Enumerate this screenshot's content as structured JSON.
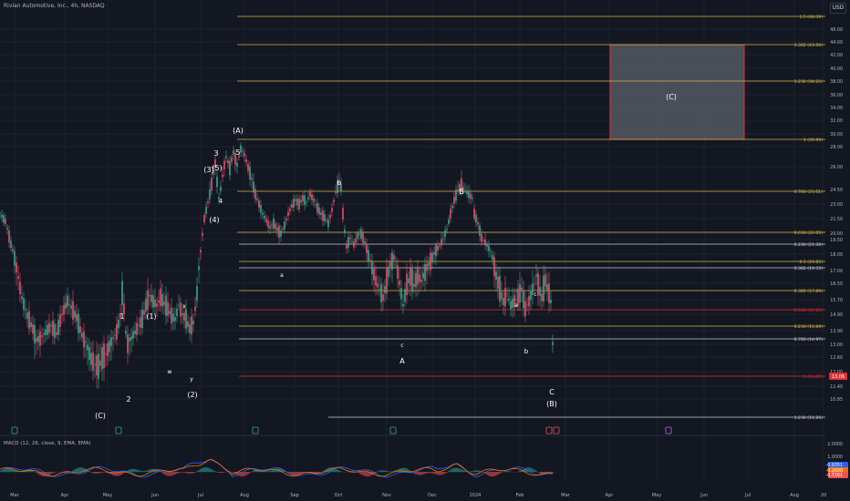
{
  "header": {
    "symbol_title": "Rivian Automotive, Inc., 4h, NASDAQ",
    "currency": "USD"
  },
  "macd": {
    "title": "MACD (12, 26, close, 9, EMA, EMA)",
    "labels": [
      "2.0000",
      "1.0000",
      "-0.9351",
      "-0.2698",
      "-0.7161"
    ]
  },
  "colors": {
    "background": "#131722",
    "fib_line": "#d4b742",
    "fib_white": "#c9cbd2",
    "fib_red": "#e03131",
    "zone_fill": "#787b86",
    "candle_up": "#3aa68e",
    "candle_down": "#e8506a",
    "macd_line": "#2962ff",
    "signal_line": "#ff6d00"
  },
  "price_axis": [
    "46.00",
    "44.00",
    "42.00",
    "40.00",
    "38.00",
    "36.00",
    "34.00",
    "32.00",
    "30.00",
    "28.00",
    "26.00",
    "24.50",
    "23.00",
    "21.50",
    "20.00",
    "19.50",
    "18.00",
    "17.00",
    "16.50",
    "15.70",
    "14.90",
    "13.90",
    "13.00",
    "12.60",
    "12.00",
    "11.40",
    "10.85"
  ],
  "time_axis": [
    "Mar",
    "Apr",
    "May",
    "Jun",
    "Jul",
    "Aug",
    "Sep",
    "Oct",
    "Nov",
    "Dec",
    "2024",
    "Feb",
    "Mar",
    "Apr",
    "May",
    "Jun",
    "Jul",
    "Aug",
    "20"
  ],
  "fib_levels": [
    {
      "label": "1.5 (48.39)",
      "color": "yellow"
    },
    {
      "label": "1.382 (43.56)",
      "color": "yellow"
    },
    {
      "label": "1.236 (38.25)",
      "color": "yellow"
    },
    {
      "label": "1 (30.99)",
      "color": "yellow"
    },
    {
      "label": "0.786 (25.61)",
      "color": "yellow"
    },
    {
      "label": "0.618 (22.05)",
      "color": "yellow"
    },
    {
      "label": "0.236 (21.30)",
      "color": "white"
    },
    {
      "label": "0.5 (19.85)",
      "color": "yellow"
    },
    {
      "label": "0.382 (19.33)",
      "color": "white"
    },
    {
      "label": "0.382 (17.89)",
      "color": "yellow"
    },
    {
      "label": "0.618 (16.65)",
      "color": "red"
    },
    {
      "label": "0.236 (15.69)",
      "color": "yellow"
    },
    {
      "label": "0.786 (14.97)",
      "color": "white"
    },
    {
      "label": "1 (13.07)",
      "color": "red"
    },
    {
      "label": "1.236 (11.26)",
      "color": "white"
    }
  ],
  "price_badge": "13.06",
  "zone_label": "(C)",
  "wave_labels": [
    "(A)",
    "5",
    "3",
    "(3)",
    "(5)",
    "(4)",
    "4",
    "1",
    "(1)",
    "x",
    "w",
    "y",
    "2",
    "(2)",
    "(C)",
    "b",
    "a",
    "c",
    "A",
    "B",
    "a",
    "b",
    "c",
    "C",
    "(B)"
  ],
  "price_series": [
    [
      0,
      22.0
    ],
    [
      6,
      21.2
    ],
    [
      12,
      19.0
    ],
    [
      18,
      17.2
    ],
    [
      24,
      15.8
    ],
    [
      30,
      14.8
    ],
    [
      36,
      14.0
    ],
    [
      40,
      13.3
    ],
    [
      44,
      13.4
    ],
    [
      50,
      13.8
    ],
    [
      56,
      14.2
    ],
    [
      62,
      13.7
    ],
    [
      68,
      14.9
    ],
    [
      74,
      15.6
    ],
    [
      78,
      15.3
    ],
    [
      84,
      14.7
    ],
    [
      90,
      13.6
    ],
    [
      96,
      12.9
    ],
    [
      100,
      12.5
    ],
    [
      104,
      12.3
    ],
    [
      108,
      12.2
    ],
    [
      112,
      12.5
    ],
    [
      116,
      12.7
    ],
    [
      120,
      13.0
    ],
    [
      124,
      13.4
    ],
    [
      128,
      13.8
    ],
    [
      132,
      14.8
    ],
    [
      134,
      16.0
    ],
    [
      136,
      15.2
    ],
    [
      138,
      13.8
    ],
    [
      140,
      13.2
    ],
    [
      144,
      13.4
    ],
    [
      148,
      13.8
    ],
    [
      152,
      14.2
    ],
    [
      156,
      14.6
    ],
    [
      160,
      15.4
    ],
    [
      164,
      15.9
    ],
    [
      168,
      15.6
    ],
    [
      172,
      15.4
    ],
    [
      176,
      15.8
    ],
    [
      180,
      15.5
    ],
    [
      184,
      15.2
    ],
    [
      188,
      14.8
    ],
    [
      192,
      14.6
    ],
    [
      196,
      15.4
    ],
    [
      200,
      14.9
    ],
    [
      204,
      14.6
    ],
    [
      208,
      14.0
    ],
    [
      212,
      14.4
    ],
    [
      216,
      16.0
    ],
    [
      220,
      18.3
    ],
    [
      224,
      21.5
    ],
    [
      228,
      23.2
    ],
    [
      232,
      24.8
    ],
    [
      236,
      26.3
    ],
    [
      238,
      25.0
    ],
    [
      240,
      23.6
    ],
    [
      244,
      25.4
    ],
    [
      248,
      27.0
    ],
    [
      252,
      26.0
    ],
    [
      256,
      27.4
    ],
    [
      260,
      26.2
    ],
    [
      264,
      27.8
    ],
    [
      268,
      27.2
    ],
    [
      272,
      26.0
    ],
    [
      276,
      25.2
    ],
    [
      280,
      24.0
    ],
    [
      284,
      23.0
    ],
    [
      288,
      22.0
    ],
    [
      292,
      21.3
    ],
    [
      296,
      20.6
    ],
    [
      300,
      21.0
    ],
    [
      304,
      20.4
    ],
    [
      308,
      20.0
    ],
    [
      312,
      20.8
    ],
    [
      316,
      22.0
    ],
    [
      320,
      22.8
    ],
    [
      324,
      23.4
    ],
    [
      328,
      23.0
    ],
    [
      332,
      23.6
    ],
    [
      336,
      23.2
    ],
    [
      340,
      24.0
    ],
    [
      344,
      23.4
    ],
    [
      348,
      22.6
    ],
    [
      352,
      22.0
    ],
    [
      356,
      21.6
    ],
    [
      360,
      21.0
    ],
    [
      364,
      22.4
    ],
    [
      368,
      24.2
    ],
    [
      372,
      25.0
    ],
    [
      374,
      24.6
    ],
    [
      376,
      22.0
    ],
    [
      378,
      20.2
    ],
    [
      380,
      18.8
    ],
    [
      384,
      19.6
    ],
    [
      388,
      19.0
    ],
    [
      392,
      19.8
    ],
    [
      396,
      20.0
    ],
    [
      400,
      19.2
    ],
    [
      404,
      18.0
    ],
    [
      408,
      17.2
    ],
    [
      412,
      16.6
    ],
    [
      416,
      16.2
    ],
    [
      420,
      15.8
    ],
    [
      424,
      16.6
    ],
    [
      428,
      17.4
    ],
    [
      432,
      17.8
    ],
    [
      436,
      17.0
    ],
    [
      440,
      16.0
    ],
    [
      442,
      15.4
    ],
    [
      446,
      16.4
    ],
    [
      450,
      16.8
    ],
    [
      454,
      16.4
    ],
    [
      458,
      16.8
    ],
    [
      462,
      16.6
    ],
    [
      466,
      17.0
    ],
    [
      470,
      17.4
    ],
    [
      474,
      17.8
    ],
    [
      478,
      18.4
    ],
    [
      482,
      18.8
    ],
    [
      486,
      19.6
    ],
    [
      490,
      20.4
    ],
    [
      494,
      22.0
    ],
    [
      498,
      23.4
    ],
    [
      502,
      24.4
    ],
    [
      506,
      24.8
    ],
    [
      510,
      24.4
    ],
    [
      514,
      24.0
    ],
    [
      518,
      23.6
    ],
    [
      520,
      22.0
    ],
    [
      524,
      21.0
    ],
    [
      528,
      19.6
    ],
    [
      532,
      19.2
    ],
    [
      536,
      18.6
    ],
    [
      540,
      17.8
    ],
    [
      544,
      16.8
    ],
    [
      548,
      16.2
    ],
    [
      552,
      15.6
    ],
    [
      556,
      16.0
    ],
    [
      560,
      15.4
    ],
    [
      564,
      15.6
    ],
    [
      568,
      15.8
    ],
    [
      572,
      16.2
    ],
    [
      576,
      15.2
    ],
    [
      580,
      15.6
    ],
    [
      584,
      16.2
    ],
    [
      588,
      16.8
    ],
    [
      590,
      16.4
    ],
    [
      594,
      15.8
    ],
    [
      598,
      16.6
    ],
    [
      602,
      16.0
    ],
    [
      605,
      15.4
    ],
    [
      606,
      13.06
    ]
  ]
}
